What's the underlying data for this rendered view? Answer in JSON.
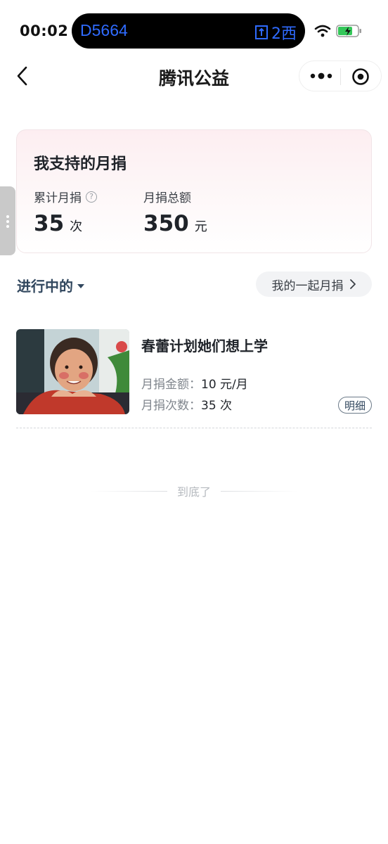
{
  "status_bar": {
    "time": "00:02",
    "train_number": "D5664",
    "gate": "2西"
  },
  "nav": {
    "title": "腾讯公益"
  },
  "summary": {
    "title": "我支持的月捐",
    "count_label": "累计月捐",
    "count_value": "35",
    "count_unit": "次",
    "total_label": "月捐总额",
    "total_value": "350",
    "total_unit": "元"
  },
  "filter": {
    "current": "进行中的",
    "together_label": "我的一起月捐"
  },
  "projects": [
    {
      "title": "春蕾计划她们想上学",
      "amount_label": "月捐金额：",
      "amount_value": "10 元/月",
      "times_label": "月捐次数：",
      "times_value": "35 次",
      "detail_label": "明细"
    }
  ],
  "footer": {
    "end_text": "到底了"
  },
  "colors": {
    "accent": "#2f6bff",
    "tag_text": "#31475e"
  }
}
